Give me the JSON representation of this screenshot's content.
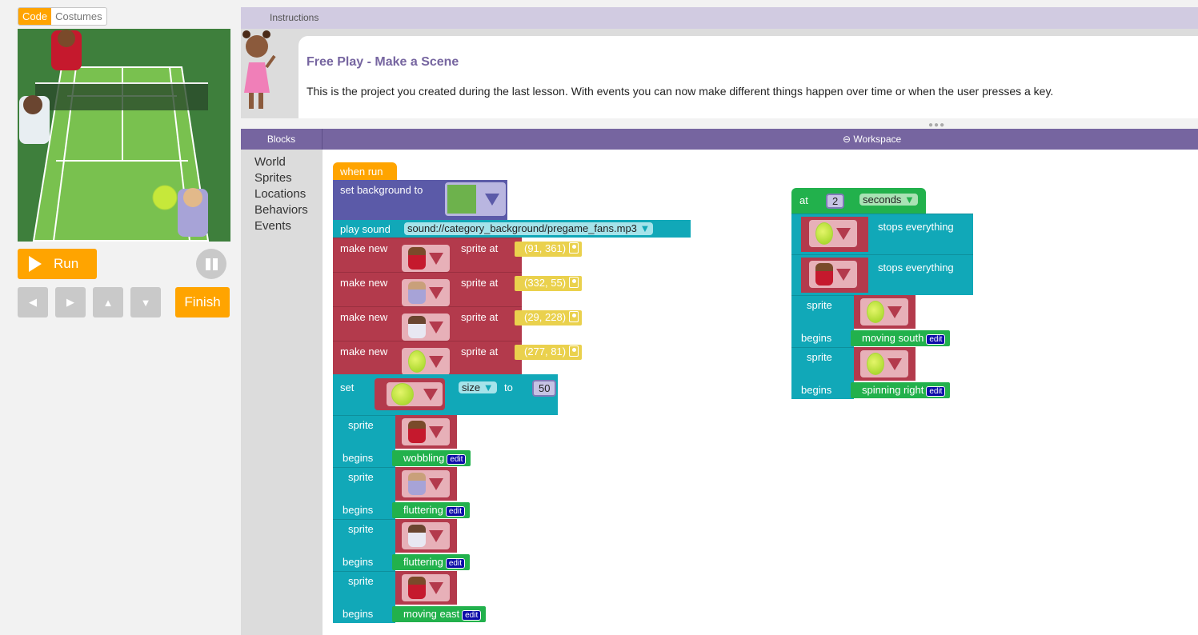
{
  "tabs": {
    "code": "Code",
    "costumes": "Costumes"
  },
  "controls": {
    "run_label": "Run",
    "finish_label": "Finish",
    "arrows": [
      "◀",
      "▶",
      "▲",
      "▼"
    ]
  },
  "instructions": {
    "header": "Instructions",
    "title": "Free Play - Make a Scene",
    "body": "This is the project you created during the last lesson. With events you can now make different things happen over time or when the user presses a key."
  },
  "bars": {
    "blocks": "Blocks",
    "workspace": "Workspace"
  },
  "toolbox": [
    "World",
    "Sprites",
    "Locations",
    "Behaviors",
    "Events"
  ],
  "script1": {
    "when_run": "when run",
    "set_background": "set background to",
    "play_sound": "play sound",
    "sound": "sound://category_background/pregame_fans.mp3",
    "make_new": "make new",
    "sprite_at": "sprite at",
    "sprites": [
      {
        "costume": "girl-red-shirt",
        "location": "(91, 361)"
      },
      {
        "costume": "boy-purple-shirt",
        "location": "(332, 55)"
      },
      {
        "costume": "boy-white-sweater",
        "location": "(29, 228)"
      },
      {
        "costume": "tennis-ball",
        "location": "(277, 81)"
      }
    ],
    "set": "set",
    "property": "size",
    "to": "to",
    "value": "50",
    "sprite": "sprite",
    "begins": "begins",
    "edit": "edit",
    "behaviors": [
      {
        "costume": "girl-red-shirt",
        "behavior": "wobbling"
      },
      {
        "costume": "boy-purple-shirt",
        "behavior": "fluttering"
      },
      {
        "costume": "boy-white-sweater",
        "behavior": "fluttering"
      },
      {
        "costume": "girl-red-shirt",
        "behavior": "moving east"
      }
    ]
  },
  "script2": {
    "at": "at",
    "seconds_value": "2",
    "unit": "seconds",
    "stops": "stops everything",
    "stop_sprites": [
      "tennis-ball",
      "girl-red-shirt"
    ],
    "sprite": "sprite",
    "begins": "begins",
    "edit": "edit",
    "behaviors": [
      {
        "costume": "tennis-ball",
        "behavior": "moving south"
      },
      {
        "costume": "tennis-ball",
        "behavior": "spinning right"
      }
    ]
  }
}
